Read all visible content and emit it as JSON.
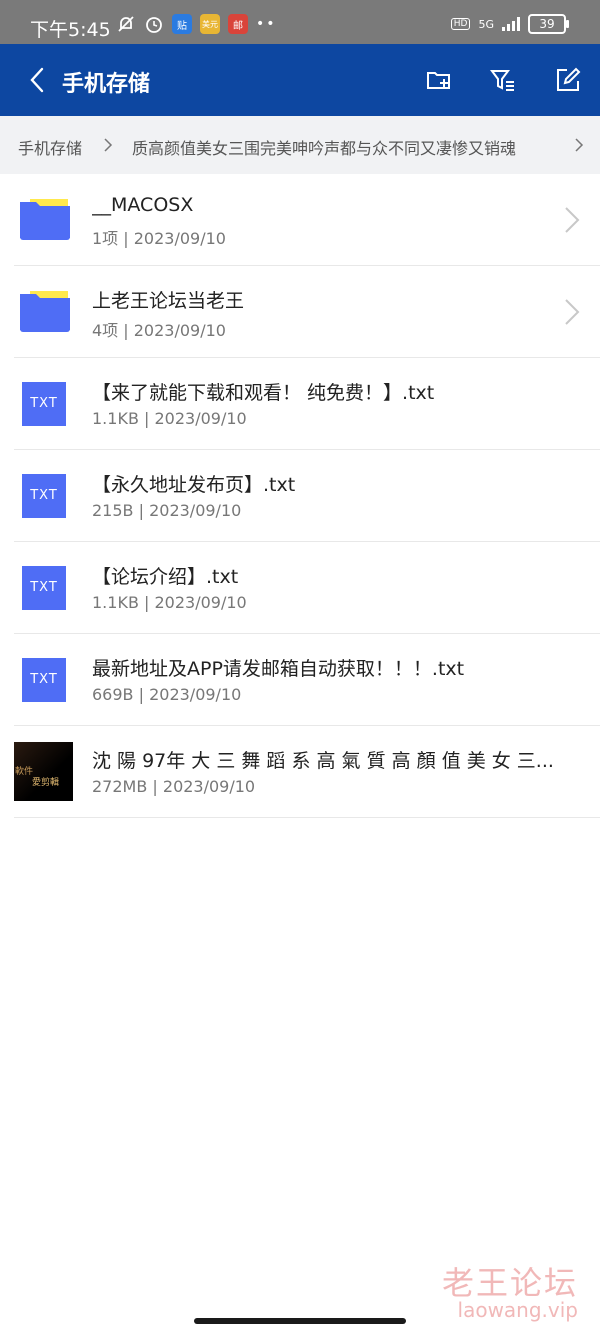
{
  "status_bar": {
    "time": "下午5:45",
    "app_icon_1": "贴",
    "app_icon_2": "美元",
    "app_icon_3": "邮",
    "hd": "HD",
    "network": "5G",
    "battery": "39"
  },
  "app_bar": {
    "title": "手机存储",
    "back_icon": "chevron-left-icon",
    "actions": [
      "new-folder-icon",
      "filter-sort-icon",
      "edit-icon"
    ]
  },
  "breadcrumb": {
    "root": "手机存储",
    "current": "质高颜值美女三围完美呻吟声都与众不同又凄惨又销魂"
  },
  "files": [
    {
      "name": "__MACOSX",
      "meta": "1项 | 2023/09/10",
      "type": "folder"
    },
    {
      "name": "上老王论坛当老王",
      "meta": "4项 | 2023/09/10",
      "type": "folder"
    },
    {
      "name": "【来了就能下载和观看！ 纯免费！】.txt",
      "meta": "1.1KB | 2023/09/10",
      "type": "txt",
      "badge": "TXT"
    },
    {
      "name": "【永久地址发布页】.txt",
      "meta": "215B | 2023/09/10",
      "type": "txt",
      "badge": "TXT"
    },
    {
      "name": "【论坛介绍】.txt",
      "meta": "1.1KB | 2023/09/10",
      "type": "txt",
      "badge": "TXT"
    },
    {
      "name": "最新地址及APP请发邮箱自动获取！！！.txt",
      "meta": "669B | 2023/09/10",
      "type": "txt",
      "badge": "TXT"
    },
    {
      "name": "沈 陽 97年 大 三 舞 蹈 系 高 氣 質 高 顏 值 美 女 三...",
      "meta": "272MB | 2023/09/10",
      "type": "video",
      "thumb_text_1": "軟件",
      "thumb_text_2": "愛剪輯"
    }
  ],
  "watermark": {
    "line1": "老王论坛",
    "line2": "laowang.vip"
  },
  "colors": {
    "app_bar": "#0d47a1",
    "folder_blue": "#4f6df5",
    "folder_yellow": "#ffe94d"
  }
}
